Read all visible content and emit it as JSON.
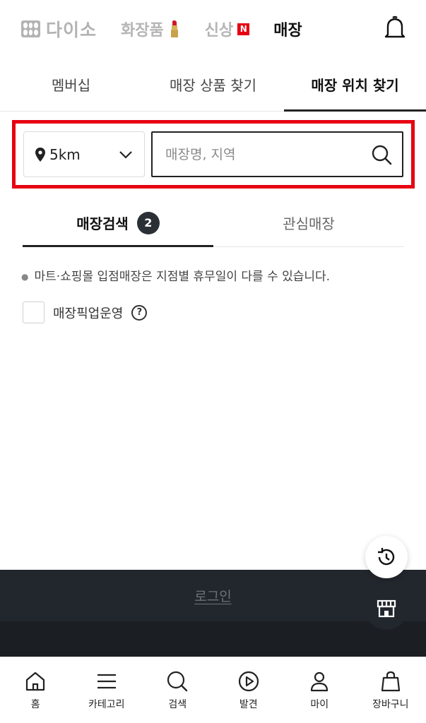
{
  "header": {
    "logo_text": "다이소",
    "nav": [
      {
        "label": "화장품",
        "icon": "lipstick-icon"
      },
      {
        "label": "신상",
        "badge": "N"
      },
      {
        "label": "매장",
        "active": true
      }
    ]
  },
  "sub_tabs": [
    {
      "label": "멤버십"
    },
    {
      "label": "매장 상품 찾기"
    },
    {
      "label": "매장 위치 찾기",
      "active": true
    }
  ],
  "search": {
    "distance": "5km",
    "placeholder": "매장명, 지역"
  },
  "store_tabs": [
    {
      "label": "매장검색",
      "count": "2",
      "active": true
    },
    {
      "label": "관심매장"
    }
  ],
  "notice": "마트·쇼핑몰 입점매장은 지점별 휴무일이 다를 수 있습니다.",
  "pickup": {
    "label": "매장픽업운영",
    "help": "?"
  },
  "footer": {
    "login": "로그인"
  },
  "bottom_nav": [
    {
      "label": "홈",
      "icon": "home-icon"
    },
    {
      "label": "카테고리",
      "icon": "menu-icon"
    },
    {
      "label": "검색",
      "icon": "search-icon"
    },
    {
      "label": "발견",
      "icon": "play-icon"
    },
    {
      "label": "마이",
      "icon": "person-icon"
    },
    {
      "label": "장바구니",
      "icon": "shopping-bag-icon"
    }
  ],
  "colors": {
    "accent": "#e60012",
    "dark": "#22262d",
    "muted": "#b5b5b5"
  }
}
